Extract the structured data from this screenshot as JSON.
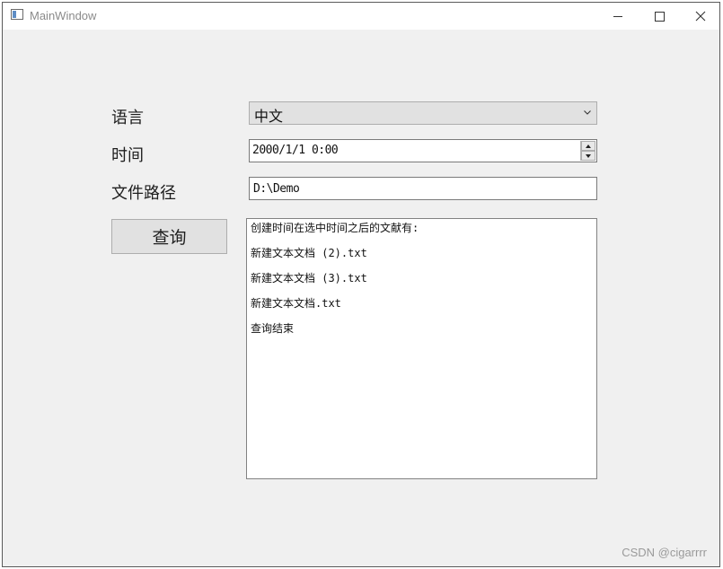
{
  "window": {
    "title": "MainWindow"
  },
  "form": {
    "language_label": "语言",
    "language_value": "中文",
    "time_label": "时间",
    "time_value": "2000/1/1 0:00",
    "path_label": "文件路径",
    "path_value": "D:\\Demo",
    "query_button": "查询"
  },
  "results": {
    "lines": [
      "创建时间在选中时间之后的文献有:",
      "新建文本文档 (2).txt",
      "新建文本文档 (3).txt",
      "新建文本文档.txt",
      "查询结束"
    ]
  },
  "watermark": "CSDN @cigarrrr",
  "icons": {
    "app": "window-app-icon",
    "minimize": "minimize-icon",
    "maximize": "maximize-icon",
    "close": "close-icon",
    "dropdown": "chevron-down-icon",
    "spin_up": "spin-up-icon",
    "spin_down": "spin-down-icon"
  }
}
